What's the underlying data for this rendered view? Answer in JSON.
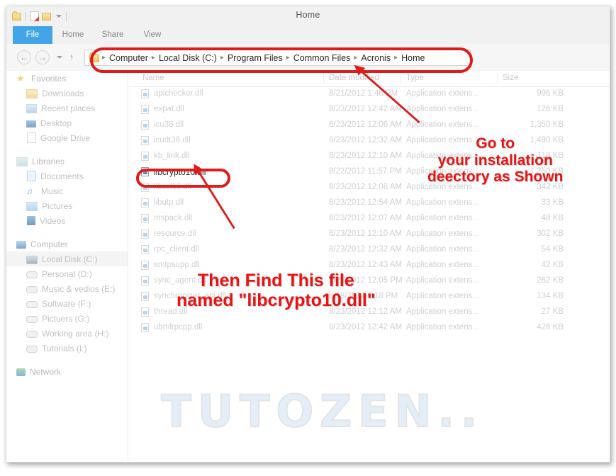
{
  "window": {
    "title": "Home",
    "quick_access": [
      {
        "name": "folder-icon"
      },
      {
        "name": "new-folder-icon"
      },
      {
        "name": "properties-icon"
      },
      {
        "name": "customize-qat-caret-icon"
      }
    ]
  },
  "ribbon": {
    "tabs": [
      {
        "label": "File",
        "active": true
      },
      {
        "label": "Home",
        "active": false
      },
      {
        "label": "Share",
        "active": false
      },
      {
        "label": "View",
        "active": false
      }
    ]
  },
  "navigation": {
    "back_glyph": "←",
    "forward_glyph": "→",
    "up_glyph": "↑",
    "breadcrumb": [
      "Computer",
      "Local Disk (C:)",
      "Program Files",
      "Common Files",
      "Acronis",
      "Home"
    ],
    "separator": "▸"
  },
  "sidebar": {
    "groups": [
      {
        "header": {
          "label": "Favorites",
          "icon": "star-icon"
        },
        "items": [
          {
            "label": "Downloads",
            "icon": "folder-icon"
          },
          {
            "label": "Recent places",
            "icon": "recent-places-icon"
          },
          {
            "label": "Desktop",
            "icon": "desktop-icon"
          },
          {
            "label": "Google Drive",
            "icon": "google-drive-icon"
          }
        ]
      },
      {
        "header": {
          "label": "Libraries",
          "icon": "libraries-icon"
        },
        "items": [
          {
            "label": "Documents",
            "icon": "documents-icon"
          },
          {
            "label": "Music",
            "icon": "music-icon"
          },
          {
            "label": "Pictures",
            "icon": "pictures-icon"
          },
          {
            "label": "Videos",
            "icon": "videos-icon"
          }
        ]
      },
      {
        "header": {
          "label": "Computer",
          "icon": "computer-icon"
        },
        "items": [
          {
            "label": "Local Disk (C:)",
            "icon": "hard-drive-icon",
            "selected": true
          },
          {
            "label": "Personal (D:)",
            "icon": "drive-icon"
          },
          {
            "label": "Music & vedios (E:)",
            "icon": "drive-icon"
          },
          {
            "label": "Software (F:)",
            "icon": "drive-icon"
          },
          {
            "label": "Pictuers (G:)",
            "icon": "drive-icon"
          },
          {
            "label": "Working  area (H:)",
            "icon": "drive-icon"
          },
          {
            "label": "Tutorials (I:)",
            "icon": "drive-icon"
          }
        ]
      },
      {
        "header": {
          "label": "Network",
          "icon": "network-icon"
        },
        "items": []
      }
    ]
  },
  "file_list": {
    "columns": [
      "Name",
      "Date modified",
      "Type",
      "Size"
    ],
    "rows": [
      {
        "name": "apichecker.dll",
        "date": "8/21/2012 1:46 PM",
        "type": "Application extens...",
        "size": "996 KB"
      },
      {
        "name": "expat.dll",
        "date": "8/23/2012 12:42 AM",
        "type": "Application extens...",
        "size": "126 KB"
      },
      {
        "name": "icu38.dll",
        "date": "8/23/2012 12:06 AM",
        "type": "Application extens...",
        "size": "1,350 KB"
      },
      {
        "name": "icudt38.dll",
        "date": "8/23/2012 12:32 AM",
        "type": "Application extens...",
        "size": "1,490 KB"
      },
      {
        "name": "kb_link.dll",
        "date": "8/23/2012 12:10 AM",
        "type": "Application extens...",
        "size": "118 KB"
      },
      {
        "name": "libcrypto10.dll",
        "date": "8/22/2012 11:57 PM",
        "type": "Application extens...",
        "size": "1,250 KB",
        "focused": true
      },
      {
        "name": "libssl10.dll",
        "date": "8/23/2012 12:08 AM",
        "type": "Application extens...",
        "size": "342 KB"
      },
      {
        "name": "libutp.dll",
        "date": "8/23/2012 12:54 AM",
        "type": "Application extens...",
        "size": "33 KB"
      },
      {
        "name": "mspack.dll",
        "date": "8/23/2012 12:07 AM",
        "type": "Application extens...",
        "size": "48 KB"
      },
      {
        "name": "resource.dll",
        "date": "8/23/2012 12:10 AM",
        "type": "Application extens...",
        "size": "302 KB"
      },
      {
        "name": "rpc_client.dll",
        "date": "8/23/2012 12:32 AM",
        "type": "Application extens...",
        "size": "54 KB"
      },
      {
        "name": "smtpsupp.dll",
        "date": "8/23/2012 12:43 AM",
        "type": "Application extens...",
        "size": "42 KB"
      },
      {
        "name": "sync_agent.dll",
        "date": "8/23/2012 12:05 PM",
        "type": "Application extens...",
        "size": "262 KB"
      },
      {
        "name": "synchronizer_api.dll",
        "date": "8/18/2012 9:18 PM",
        "type": "Application extens...",
        "size": "134 KB"
      },
      {
        "name": "thread.dll",
        "date": "8/23/2012 12:12 AM",
        "type": "Application extens...",
        "size": "27 KB"
      },
      {
        "name": "ubmlrpcpp.dll",
        "date": "8/23/2012 12:42 AM",
        "type": "Application extens...",
        "size": "426 KB"
      }
    ]
  },
  "annotations": {
    "accent_color": "#ee1111",
    "callout_1": "Go to\nyour installation\ndeectory as Shown",
    "callout_2": "Then Find This file\nnamed \"libcrypto10.dll\""
  },
  "watermark": {
    "text": "TUTOZEN.."
  }
}
